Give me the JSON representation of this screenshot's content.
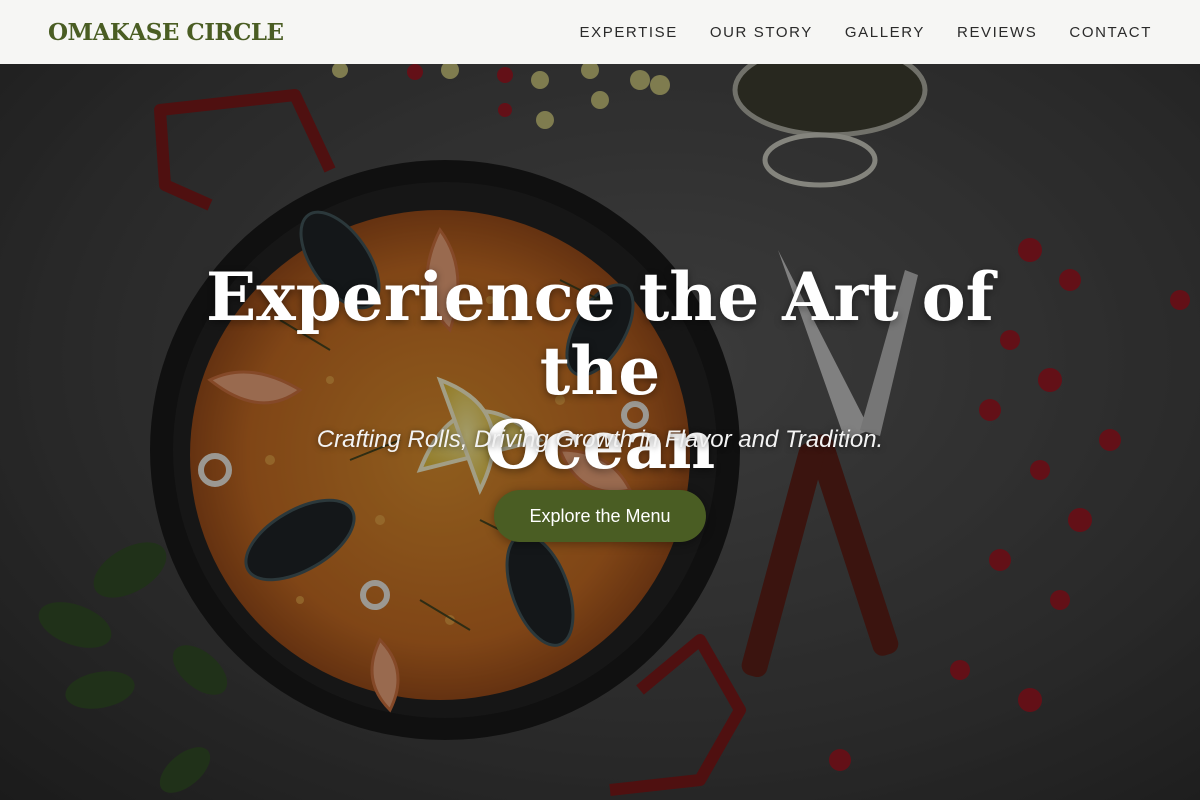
{
  "header": {
    "brand": "OMAKASE CIRCLE",
    "nav": [
      {
        "label": "EXPERTISE"
      },
      {
        "label": "OUR STORY"
      },
      {
        "label": "GALLERY"
      },
      {
        "label": "REVIEWS"
      },
      {
        "label": "CONTACT"
      }
    ]
  },
  "hero": {
    "title_line1": "Experience the Art of the",
    "title_line2": "Ocean",
    "subtitle": "Crafting Rolls, Driving Growth in Flavor and Tradition.",
    "cta_label": "Explore the Menu",
    "background_image": "paella-pan-with-seafood-on-dark-table"
  },
  "colors": {
    "brand": "#4a5d23",
    "header_bg": "#f6f6f4",
    "nav_text": "#2a2a2a",
    "cta_bg": "#4a5d23",
    "cta_text": "#ffffff"
  }
}
